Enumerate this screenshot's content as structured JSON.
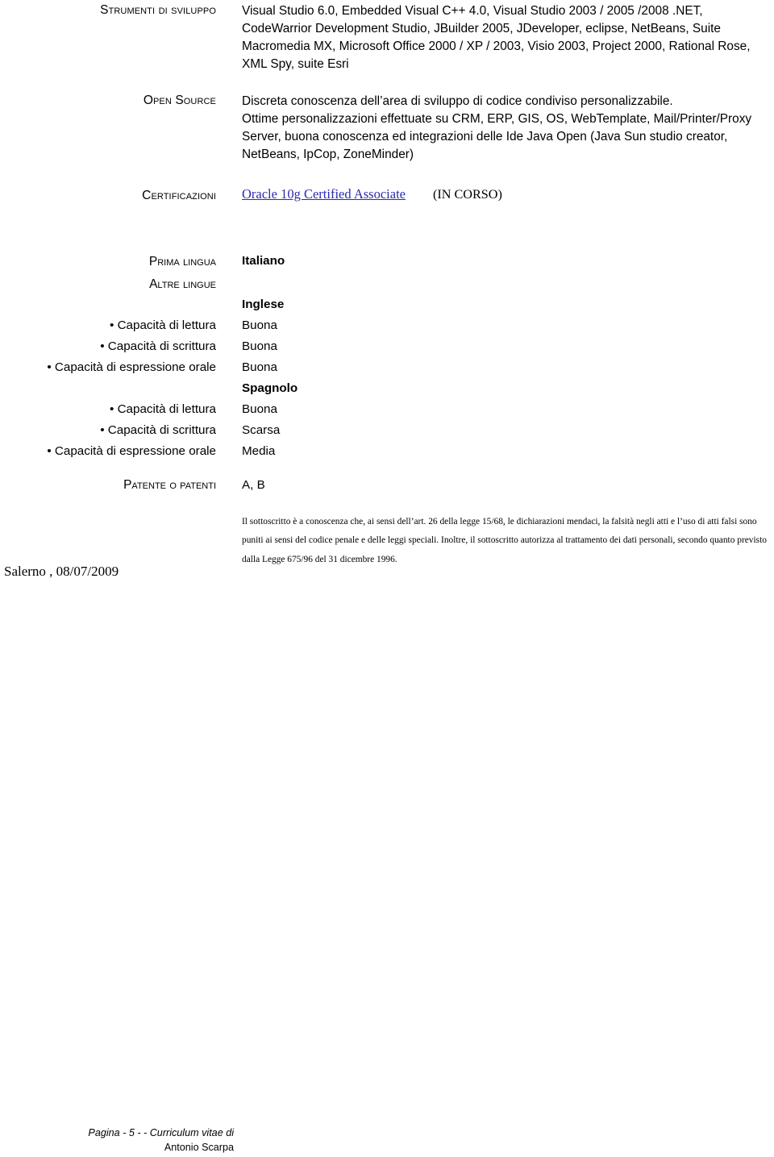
{
  "document": {
    "type": "curriculum-vitae",
    "page_number": "5",
    "link_color": "#2a2ab0",
    "text_color": "#000000",
    "background_color": "#ffffff"
  },
  "sections": {
    "dev_tools": {
      "label": "Strumenti di sviluppo",
      "lines": [
        "Visual Studio 6.0, Embedded Visual C++ 4.0, Visual Studio 2003 / 2005 /2008 .NET,",
        "CodeWarrior Development Studio, JBuilder 2005, JDeveloper, eclipse, NetBeans, Suite",
        "Macromedia MX, Microsoft Office 2000 / XP / 2003, Visio 2003, Project 2000, Rational Rose,",
        "XML Spy, suite Esri"
      ]
    },
    "open_source": {
      "label": "Open Source",
      "lines": [
        "Discreta conoscenza dell’area di sviluppo di codice condiviso personalizzabile.",
        "Ottime personalizzazioni effettuate su CRM, ERP, GIS, OS, WebTemplate, Mail/Printer/Proxy",
        "Server,   buona conoscenza ed integrazioni delle Ide Java Open (Java Sun studio creator,",
        "NetBeans, IpCop, ZoneMinder)"
      ]
    },
    "certifications": {
      "label": "Certificazioni",
      "link_text": "Oracle 10g Certified Associate",
      "status_text": "(IN CORSO)"
    }
  },
  "languages": {
    "first_language_label": "Prima lingua",
    "first_language_value": "Italiano",
    "other_languages_label": "Altre lingue",
    "entries": [
      {
        "name": "Inglese",
        "skills": [
          {
            "label": "• Capacità di lettura",
            "value": "Buona"
          },
          {
            "label": "• Capacità di scrittura",
            "value": "Buona"
          },
          {
            "label": "• Capacità di espressione orale",
            "value": "Buona"
          }
        ]
      },
      {
        "name": "Spagnolo",
        "skills": [
          {
            "label": "• Capacità di lettura",
            "value": "Buona"
          },
          {
            "label": "• Capacità di scrittura",
            "value": "Scarsa"
          },
          {
            "label": "• Capacità di espressione orale",
            "value": "Media"
          }
        ]
      }
    ]
  },
  "license": {
    "label": "Patente o patenti",
    "value": "A, B"
  },
  "declaration": {
    "text": "Il sottoscritto è a conoscenza che, ai sensi dell’art. 26 della legge 15/68, le dichiarazioni mendaci, la falsità negli atti e l’uso di atti falsi sono puniti ai sensi del codice penale e delle leggi speciali. Inoltre, il sottoscritto autorizza al trattamento dei dati personali, secondo quanto previsto dalla Legge 675/96 del 31 dicembre 1996."
  },
  "signature": {
    "place_date": "Salerno , 08/07/2009"
  },
  "footer": {
    "line1": "Pagina - 5 - - Curriculum vitae di",
    "line2": "Antonio Scarpa"
  }
}
